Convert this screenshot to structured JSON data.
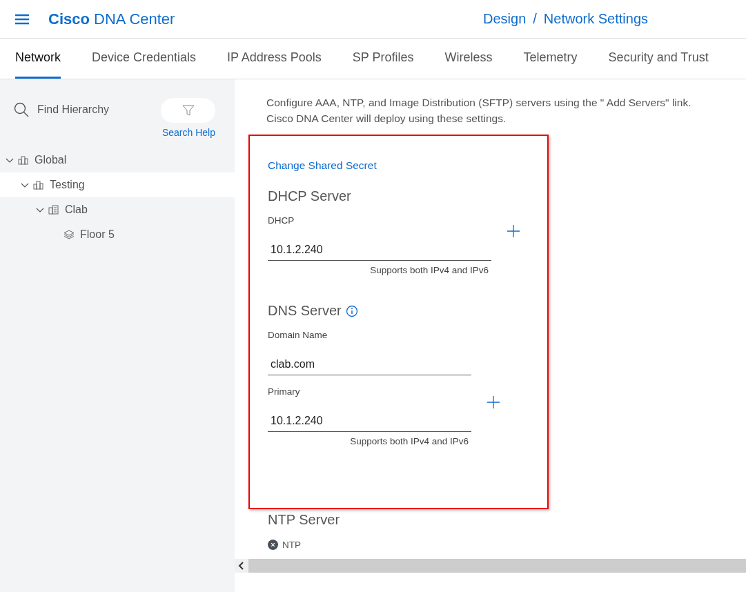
{
  "header": {
    "product_bold": "Cisco",
    "product": "DNA Center",
    "breadcrumb": [
      {
        "label": "Design"
      },
      {
        "label": "Network Settings"
      }
    ],
    "separator": "/"
  },
  "tabs": [
    {
      "label": "Network",
      "selected": true
    },
    {
      "label": "Device Credentials",
      "selected": false
    },
    {
      "label": "IP Address Pools",
      "selected": false
    },
    {
      "label": "SP Profiles",
      "selected": false
    },
    {
      "label": "Wireless",
      "selected": false
    },
    {
      "label": "Telemetry",
      "selected": false
    },
    {
      "label": "Security and Trust",
      "selected": false
    }
  ],
  "sidebar": {
    "search": {
      "placeholder": "Find Hierarchy"
    },
    "search_help": "Search Help",
    "tree": [
      {
        "label": "Global",
        "kind": "area",
        "expanded": true,
        "selected": false,
        "children": [
          {
            "label": "Testing",
            "kind": "area",
            "expanded": true,
            "selected": true,
            "children": [
              {
                "label": "Clab",
                "kind": "building",
                "expanded": true,
                "selected": false,
                "children": [
                  {
                    "label": "Floor 5",
                    "kind": "floor",
                    "selected": false
                  }
                ]
              }
            ]
          }
        ]
      }
    ]
  },
  "description": [
    "Configure AAA, NTP, and Image Distribution (SFTP) servers using the \" Add Servers\"  link.",
    "Cisco DNA Center will deploy using these settings."
  ],
  "panel": {
    "link": "Change Shared Secret",
    "sections": [
      {
        "title": "DHCP Server",
        "info": false,
        "fields": [
          {
            "label": "DHCP",
            "value": "10.1.2.240",
            "hint": "Supports both IPv4 and IPv6",
            "kind": "wide",
            "addable": true
          }
        ]
      },
      {
        "title": "DNS Server",
        "info": true,
        "fields": [
          {
            "label": "Domain Name",
            "value": "clab.com",
            "kind": "narrow",
            "addable": false
          },
          {
            "label": "Primary",
            "value": "10.1.2.240",
            "hint": "Supports both IPv4 and IPv6",
            "kind": "narrow",
            "addable": true
          }
        ]
      }
    ]
  },
  "ntp": {
    "title": "NTP Server",
    "chip": "NTP"
  }
}
